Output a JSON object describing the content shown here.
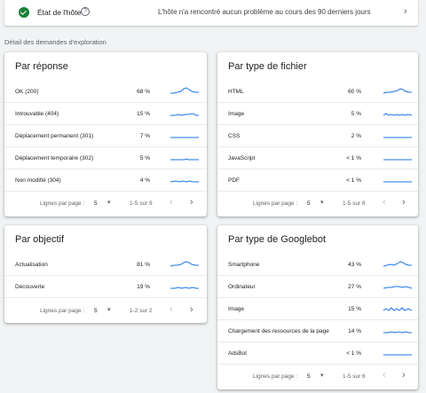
{
  "host": {
    "title": "État de l'hôte",
    "status": "L'hôte n'a rencontré aucun problème au cours des 90 derniers jours"
  },
  "section_label": "Détail des demandes d'exploration",
  "cards": {
    "response": {
      "title": "Par réponse",
      "rows": [
        {
          "label": "OK (200)",
          "pct": "68 %"
        },
        {
          "label": "Introuvable (404)",
          "pct": "15 %"
        },
        {
          "label": "Déplacement permanent (301)",
          "pct": "7 %"
        },
        {
          "label": "Déplacement temporaire (302)",
          "pct": "5 %"
        },
        {
          "label": "Non modifié (304)",
          "pct": "4 %"
        }
      ],
      "pager": {
        "rows_label": "Lignes par page :",
        "rows_value": "5",
        "range": "1-5 sur 9"
      }
    },
    "filetype": {
      "title": "Par type de fichier",
      "rows": [
        {
          "label": "HTML",
          "pct": "60 %"
        },
        {
          "label": "Image",
          "pct": "5 %"
        },
        {
          "label": "CSS",
          "pct": "2 %"
        },
        {
          "label": "JavaScript",
          "pct": "< 1 %"
        },
        {
          "label": "PDF",
          "pct": "< 1 %"
        }
      ],
      "pager": {
        "rows_label": "Lignes par page :",
        "rows_value": "5",
        "range": "1-5 sur 8"
      }
    },
    "purpose": {
      "title": "Par objectif",
      "rows": [
        {
          "label": "Actualisation",
          "pct": "81 %"
        },
        {
          "label": "Découverte",
          "pct": "19 %"
        }
      ],
      "pager": {
        "rows_label": "Lignes par page :",
        "rows_value": "5",
        "range": "1-2 sur 2"
      }
    },
    "googlebot": {
      "title": "Par type de Googlebot",
      "rows": [
        {
          "label": "Smartphone",
          "pct": "43 %"
        },
        {
          "label": "Ordinateur",
          "pct": "27 %"
        },
        {
          "label": "Image",
          "pct": "15 %"
        },
        {
          "label": "Chargement des ressources de la page",
          "pct": "14 %"
        },
        {
          "label": "AdsBot",
          "pct": "< 1 %"
        }
      ],
      "pager": {
        "rows_label": "Lignes par page :",
        "rows_value": "5",
        "range": "1-5 sur 6"
      }
    }
  },
  "colors": {
    "accent": "#1a73e8",
    "success": "#188038"
  },
  "icons": {
    "status": "check-circle-icon",
    "help": "help-icon",
    "next": "chevron-right-icon",
    "prev": "chevron-left-icon",
    "dropdown": "dropdown-icon"
  }
}
